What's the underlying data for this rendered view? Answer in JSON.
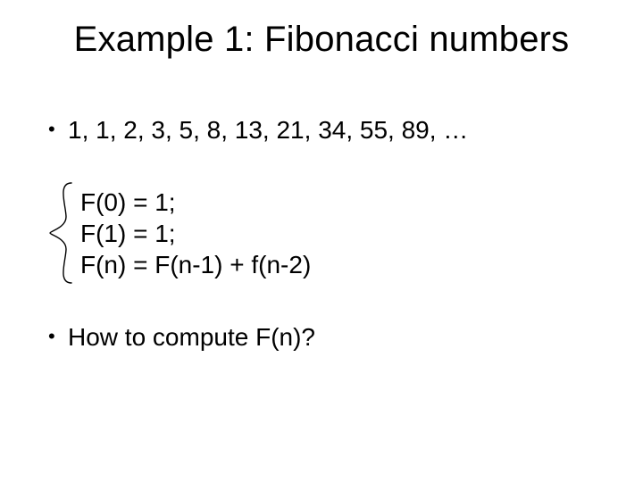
{
  "title": "Example 1: Fibonacci numbers",
  "bullets": {
    "sequence": "1, 1, 2, 3, 5, 8, 13, 21, 34, 55, 89, …",
    "question": "How to compute F(n)?"
  },
  "definition": {
    "line1": "F(0) = 1;",
    "line2": "F(1) = 1;",
    "line3": "F(n) = F(n-1) + f(n-2)"
  },
  "glyphs": {
    "bullet": "•"
  }
}
